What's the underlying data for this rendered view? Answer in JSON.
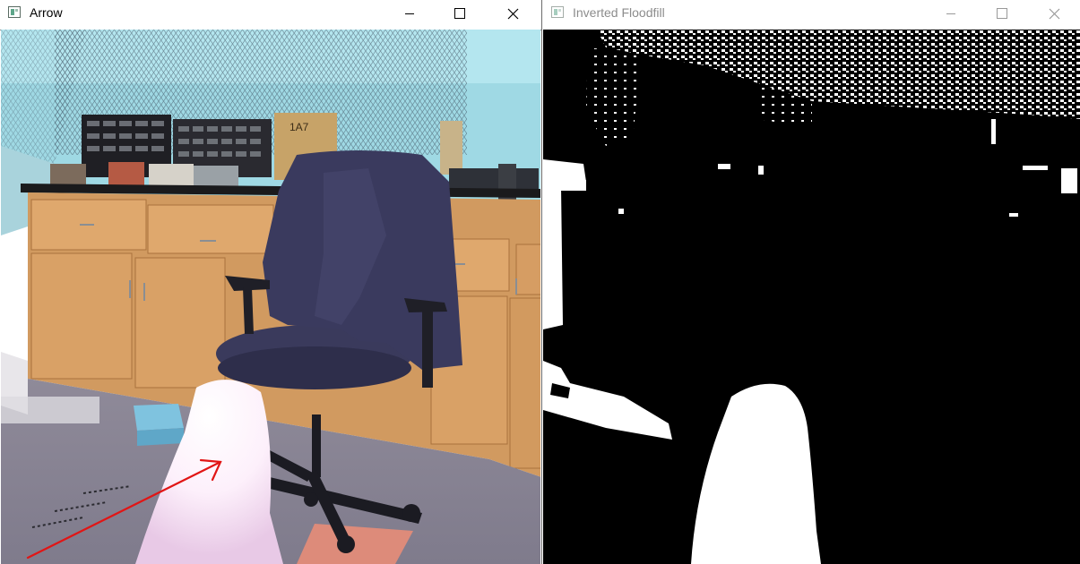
{
  "windows": [
    {
      "title": "Arrow",
      "state": "active",
      "controls": {
        "minimize_icon": "minimize-icon",
        "maximize_icon": "maximize-icon",
        "close_icon": "close-icon"
      }
    },
    {
      "title": "Inverted Floodfill",
      "state": "inactive",
      "controls": {
        "minimize_icon": "minimize-icon",
        "maximize_icon": "maximize-icon",
        "close_icon": "close-icon"
      }
    }
  ],
  "colors": {
    "arrow": "#e11515",
    "title_active": "#000000",
    "title_inactive": "#8c8c8c",
    "mask_fg": "#ffffff",
    "mask_bg": "#000000"
  },
  "cabinet_label": "1A7"
}
